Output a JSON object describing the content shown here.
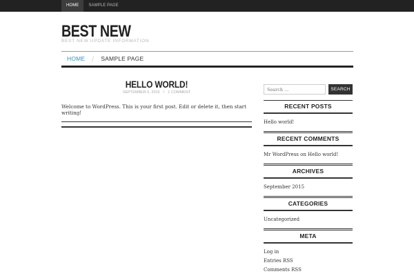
{
  "topnav": {
    "items": [
      {
        "label": "Home"
      },
      {
        "label": "Sample Page"
      }
    ]
  },
  "header": {
    "title": "Best New",
    "description": "Best New Update Information"
  },
  "mainnav": {
    "items": [
      {
        "label": "Home"
      },
      {
        "label": "Sample Page"
      }
    ]
  },
  "post": {
    "title": "Hello world!",
    "date": "September 6, 2015",
    "comments": "1 Comment",
    "body": "Welcome to WordPress. This is your first post. Edit or delete it, then start writing!"
  },
  "search": {
    "placeholder": "Search ...",
    "button": "Search"
  },
  "widgets": {
    "recent_posts": {
      "title": "Recent Posts",
      "items": [
        "Hello world!"
      ]
    },
    "recent_comments": {
      "title": "Recent Comments",
      "items": [
        "Mr WordPress on Hello world!"
      ]
    },
    "archives": {
      "title": "Archives",
      "items": [
        "September 2015"
      ]
    },
    "categories": {
      "title": "Categories",
      "items": [
        "Uncategorized"
      ]
    },
    "meta": {
      "title": "Meta",
      "items": [
        "Log in",
        "Entries RSS",
        "Comments RSS"
      ]
    }
  },
  "colors": {
    "accent": "#3a8fb7",
    "topbar": "#222222"
  }
}
